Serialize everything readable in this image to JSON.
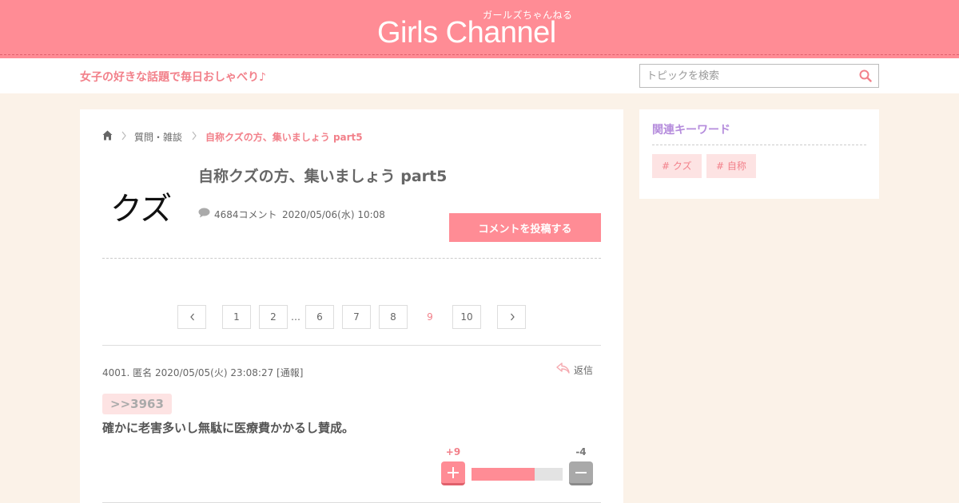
{
  "header": {
    "logo_text": "Girls Channel",
    "logo_subtext": "ガールズちゃんねる",
    "tagline": "女子の好きな話題で毎日おしゃべり♪",
    "search_placeholder": "トピックを検索"
  },
  "breadcrumb": {
    "category": "質問・雑談",
    "current": "自称クズの方、集いましょう part5"
  },
  "topic": {
    "thumbnail_text": "クズ",
    "title": "自称クズの方、集いましょう part5",
    "comment_count": "4684コメント",
    "date": "2020/05/06(水) 10:08",
    "post_button_label": "コメントを投稿する"
  },
  "pagination": {
    "pages": [
      "1",
      "2",
      "6",
      "7",
      "8",
      "9",
      "10"
    ],
    "ellipsis": "…",
    "current": "9"
  },
  "comment": {
    "header": "4001. 匿名 2020/05/05(火) 23:08:27  [通報]",
    "reply_label": "返信",
    "anchor": ">>3963",
    "body": "確かに老害多いし無駄に医療費かかるし賛成。",
    "plus": "+9",
    "minus": "-4",
    "plus_fraction": 0.69
  },
  "sidebar": {
    "title": "関連キーワード",
    "keywords": [
      "# クズ",
      "# 自称"
    ]
  },
  "colors": {
    "brand_pink": "#ff8c95",
    "accent_text": "#f2808a",
    "sidebar_title": "#b58cdc",
    "background": "#fbf2e8"
  }
}
